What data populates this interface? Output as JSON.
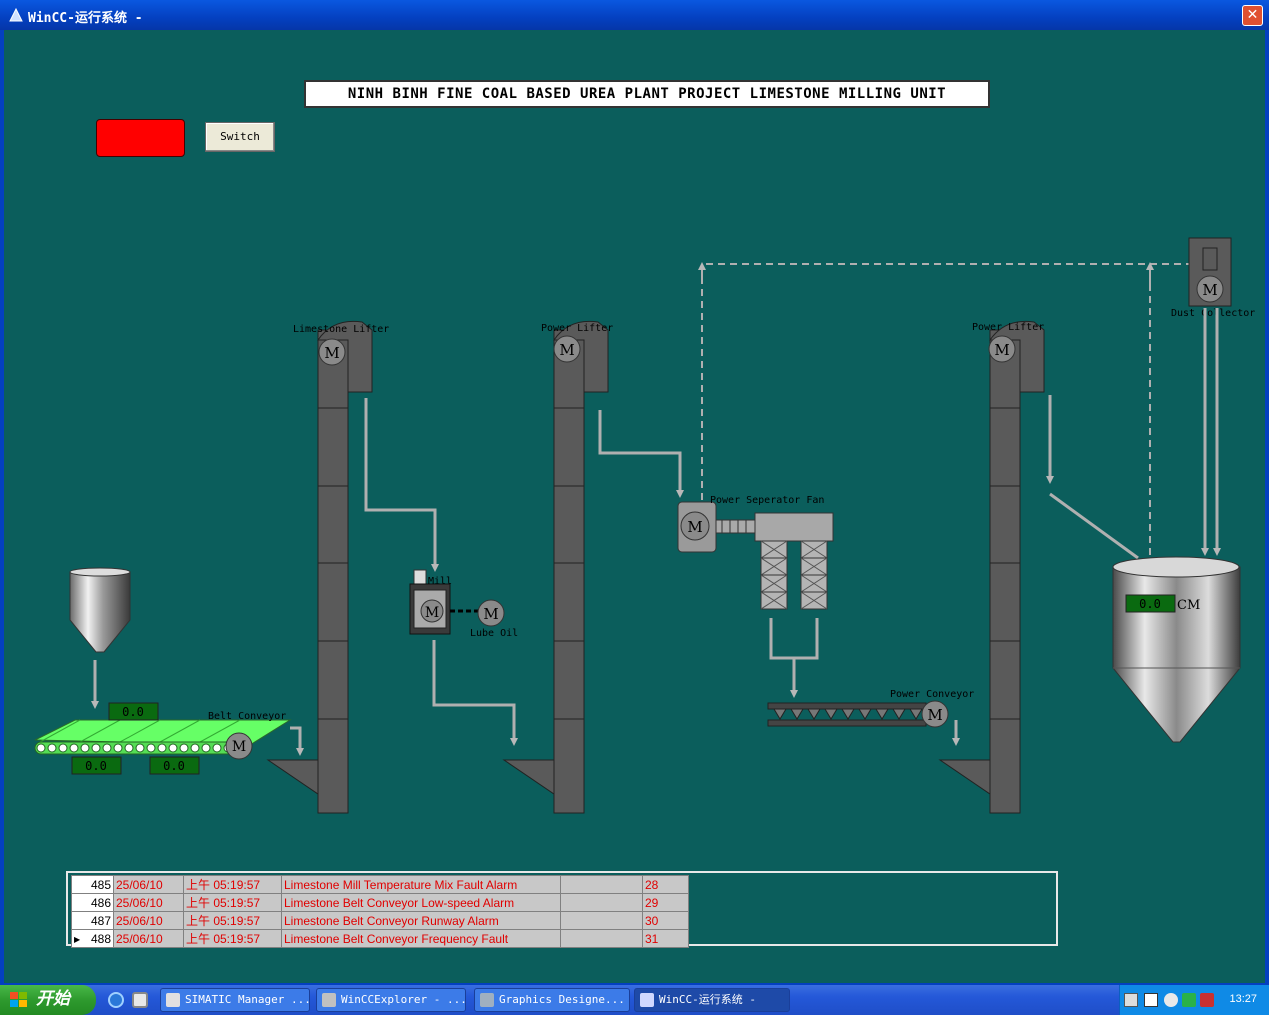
{
  "window": {
    "title": "WinCC-运行系统 -",
    "close_label": "✕"
  },
  "banner": {
    "text": "NINH BINH FINE COAL BASED UREA PLANT PROJECT LIMESTONE MILLING UNIT"
  },
  "controls": {
    "switch_label": "Switch"
  },
  "equipment": {
    "limestone_lifter": "Limestone Lifter",
    "power_lifter_1": "Power Lifter",
    "power_lifter_2": "Power Lifter",
    "mill": "Mill",
    "lube_oil": "Lube Oil",
    "separator_fan": "Power Seperator Fan",
    "dust_collector": "Dust Collector",
    "power_conveyor": "Power Conveyor",
    "belt_conveyor": "Belt Conveyor",
    "motor_letter": "M",
    "silo_unit": "CM"
  },
  "readouts": {
    "belt_top": "0.0",
    "belt_left": "0.0",
    "belt_right": "0.0",
    "silo_level": "0.0"
  },
  "alarms": [
    {
      "no": "485",
      "date": "25/06/10",
      "time": "上午 05:19:57",
      "message": "Limestone Mill Temperature Mix Fault Alarm",
      "extra": "",
      "code": "28",
      "selected": false
    },
    {
      "no": "486",
      "date": "25/06/10",
      "time": "上午 05:19:57",
      "message": "Limestone Belt Conveyor Low-speed Alarm",
      "extra": "",
      "code": "29",
      "selected": false
    },
    {
      "no": "487",
      "date": "25/06/10",
      "time": "上午 05:19:57",
      "message": "Limestone Belt Conveyor Runway Alarm",
      "extra": "",
      "code": "30",
      "selected": false
    },
    {
      "no": "488",
      "date": "25/06/10",
      "time": "上午 05:19:57",
      "message": "Limestone Belt Conveyor Frequency Fault",
      "extra": "",
      "code": "31",
      "selected": true
    }
  ],
  "taskbar": {
    "start_label": "开始",
    "tasks": [
      {
        "label": "SIMATIC Manager ...",
        "active": false
      },
      {
        "label": "WinCCExplorer - ...",
        "active": false
      },
      {
        "label": "Graphics Designe...",
        "active": false
      },
      {
        "label": "WinCC-运行系统 -",
        "active": true
      }
    ],
    "clock": "13:27"
  },
  "colors": {
    "background": "#0b5e5c",
    "alarm_light": "#ff0000",
    "belt_green": "#66ff66",
    "readout_bg": "#0a6a10",
    "equipment_gray": "#5a5a5a",
    "pipe_gray": "#b0b0b0"
  }
}
